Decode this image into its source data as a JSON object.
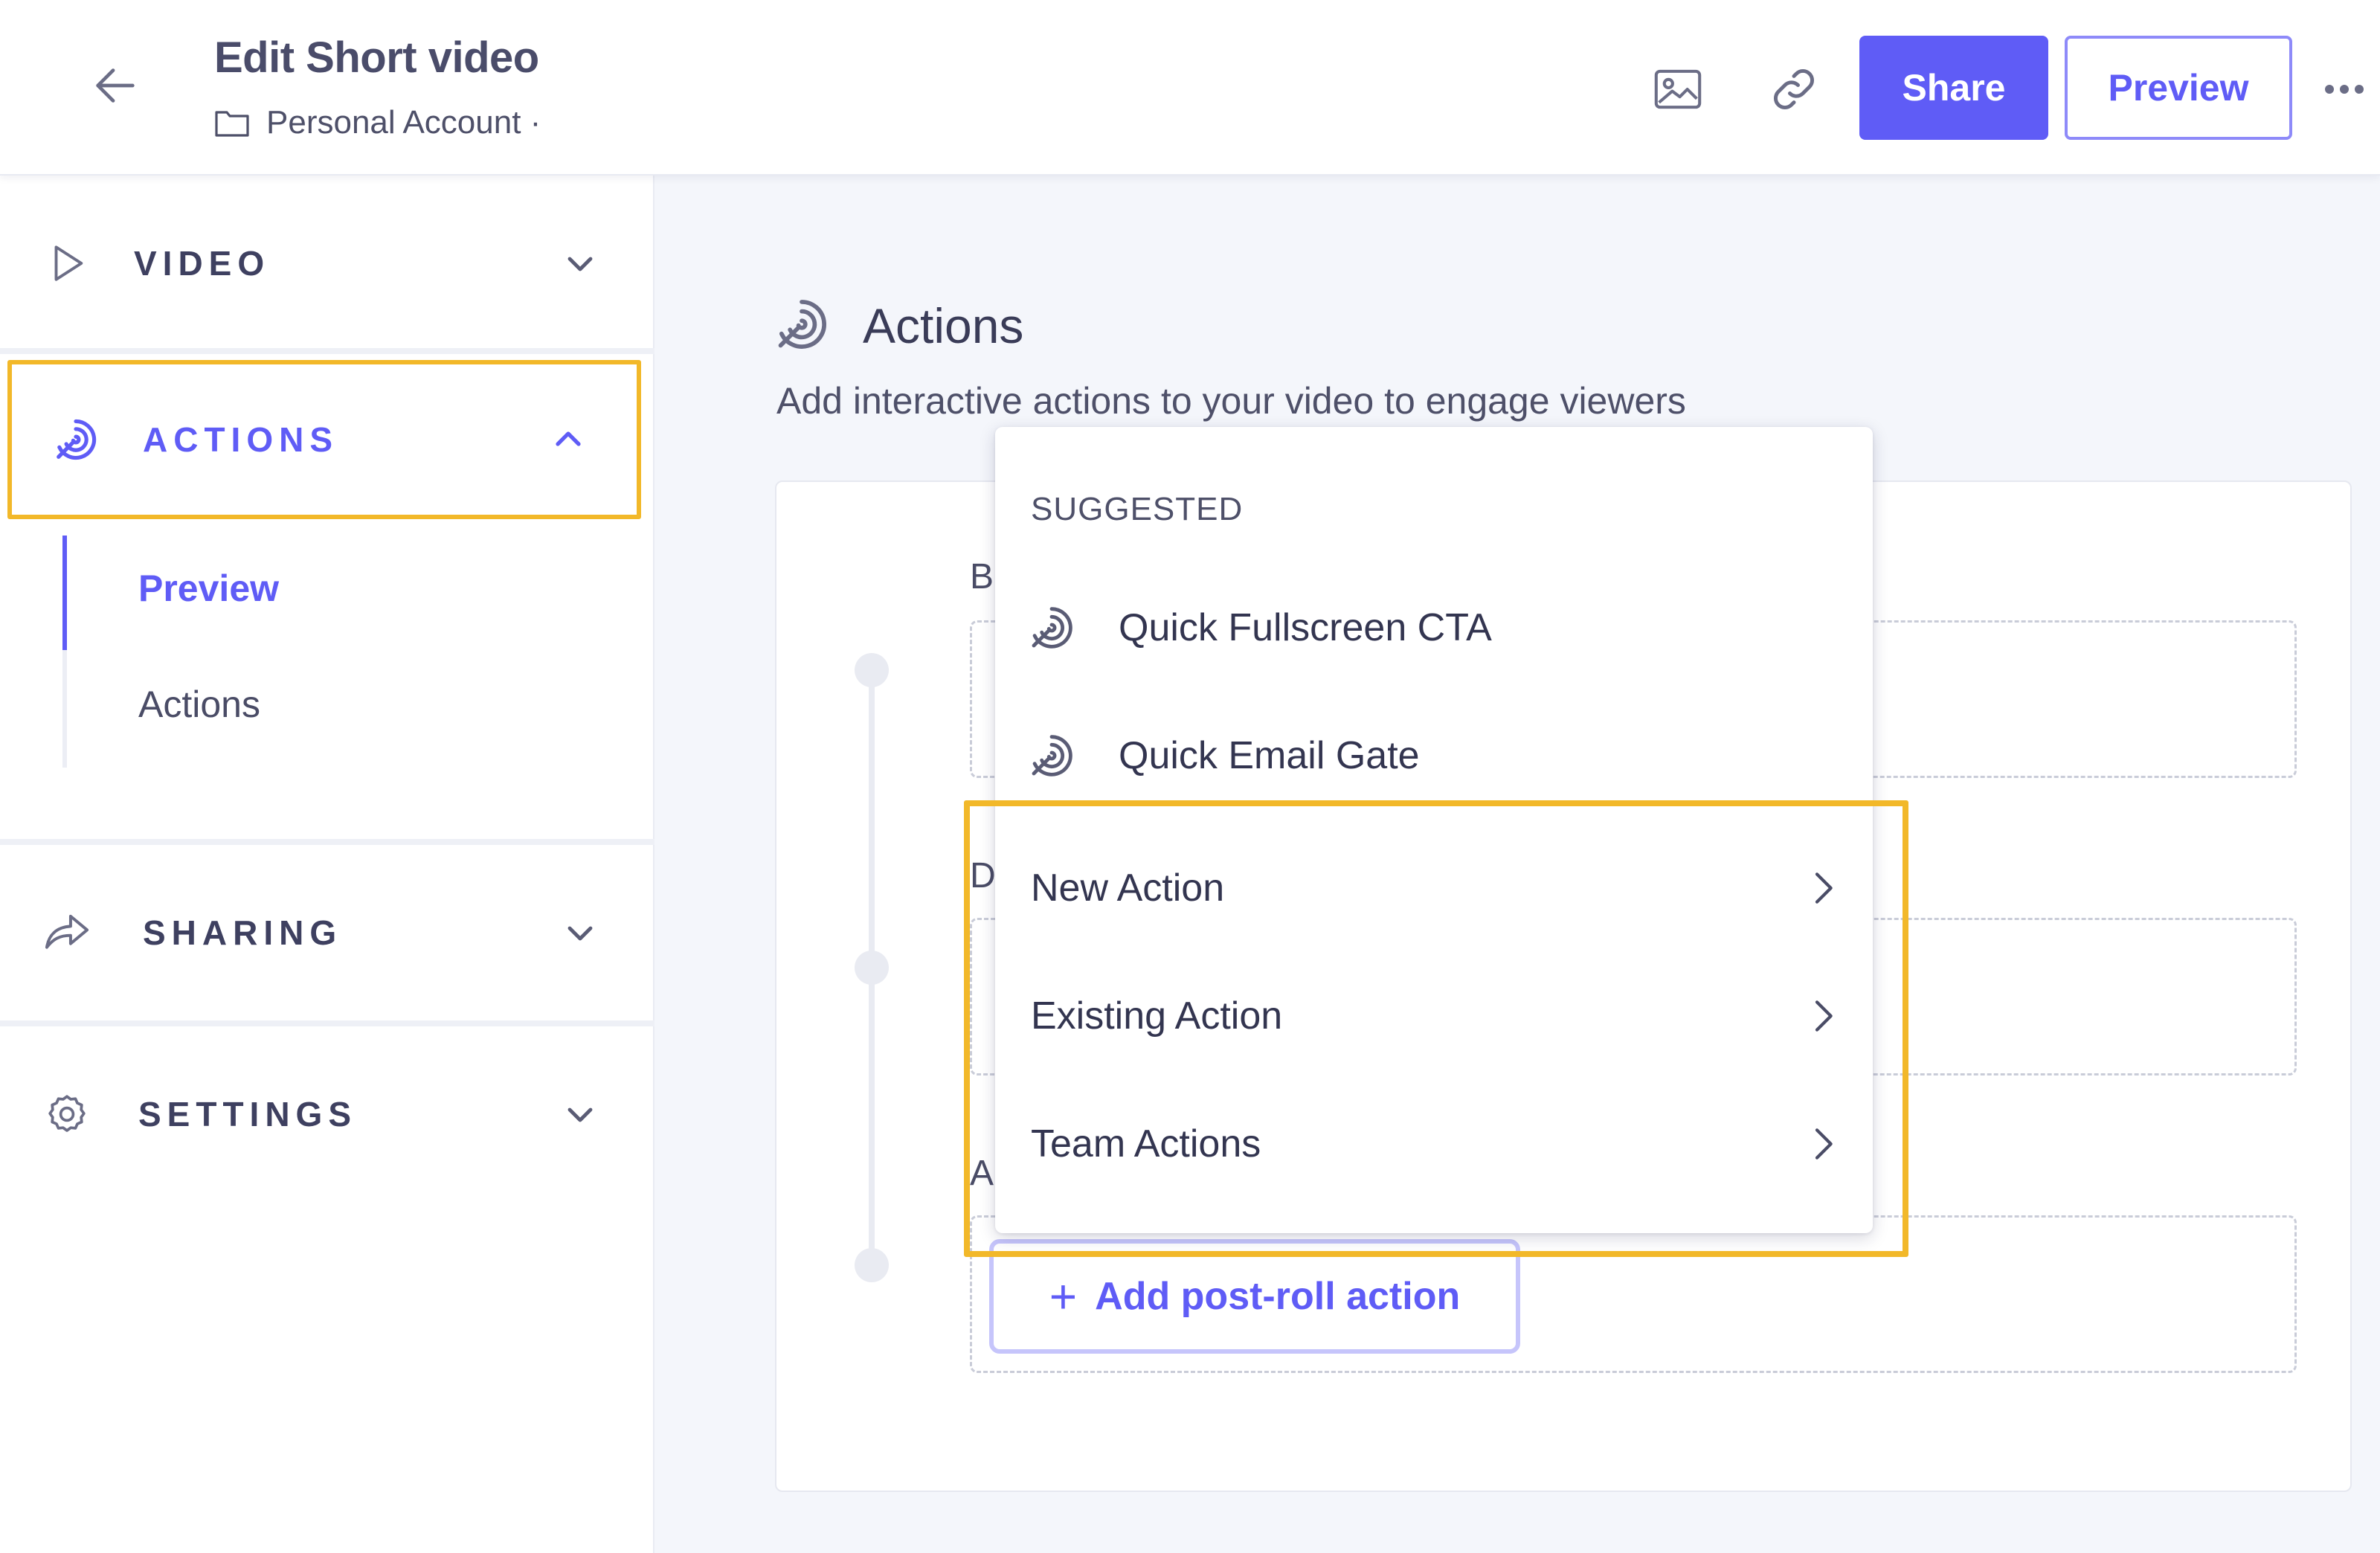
{
  "header": {
    "title": "Edit Short video",
    "breadcrumb": "Personal Account ·",
    "share_label": "Share",
    "preview_label": "Preview",
    "icons": [
      "back-arrow-icon",
      "folder-icon",
      "image-icon",
      "link-icon",
      "more-icon"
    ]
  },
  "sidebar": {
    "video_label": "VIDEO",
    "actions_label": "ACTIONS",
    "sharing_label": "SHARING",
    "settings_label": "SETTINGS",
    "subnav": [
      "Preview",
      "Actions"
    ]
  },
  "main": {
    "title": "Actions",
    "subtitle": "Add interactive actions to your video to engage viewers",
    "segment_labels": [
      "B",
      "D",
      "A"
    ],
    "add_post_roll_label": "Add post-roll action"
  },
  "dropdown": {
    "section_label": "SUGGESTED",
    "suggested": [
      "Quick Fullscreen CTA",
      "Quick Email Gate"
    ],
    "nested": [
      "New Action",
      "Existing Action",
      "Team Actions"
    ]
  },
  "colors": {
    "accent": "#5f5cf6",
    "highlight": "#f2b829",
    "text": "#3b3d5c",
    "background": "#f4f6fb"
  }
}
